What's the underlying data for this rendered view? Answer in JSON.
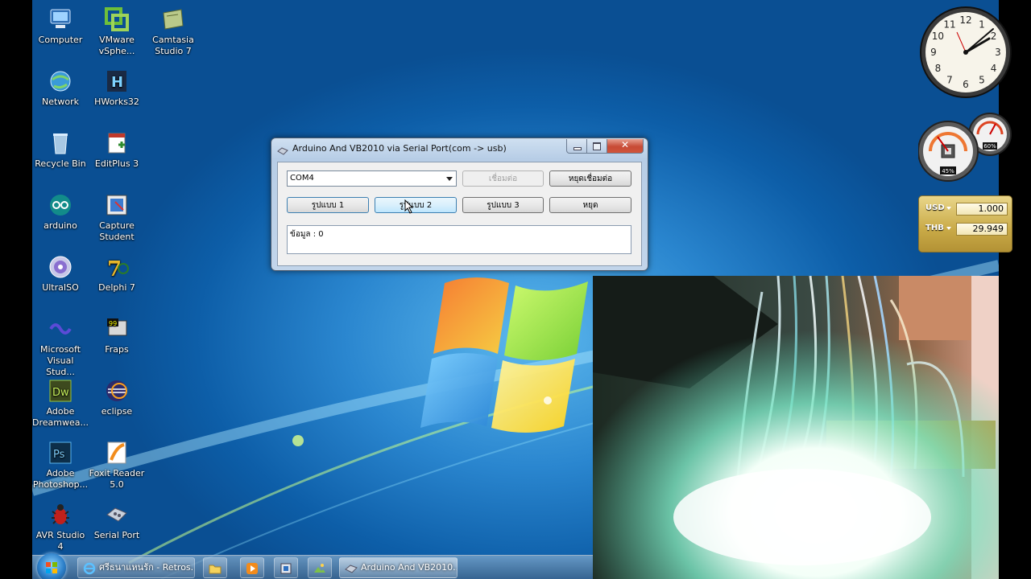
{
  "desktop_icons": [
    {
      "label": "Computer"
    },
    {
      "label": "VMware\nvSphe..."
    },
    {
      "label": "Camtasia\nStudio 7"
    },
    {
      "label": "Network"
    },
    {
      "label": "HWorks32"
    },
    {
      "label": "Recycle Bin"
    },
    {
      "label": "EditPlus 3"
    },
    {
      "label": "arduino"
    },
    {
      "label": "Capture\nStudent"
    },
    {
      "label": "UltraISO"
    },
    {
      "label": "Delphi 7"
    },
    {
      "label": "Microsoft\nVisual Stud..."
    },
    {
      "label": "Fraps"
    },
    {
      "label": "Adobe\nDreamwea..."
    },
    {
      "label": "eclipse"
    },
    {
      "label": "Adobe\nPhotoshop..."
    },
    {
      "label": "Foxit Reader\n5.0"
    },
    {
      "label": "AVR Studio 4"
    },
    {
      "label": "Serial Port"
    }
  ],
  "window": {
    "title": "Arduino And VB2010 via Serial Port(com -> usb)",
    "port_combo": {
      "value": "COM4"
    },
    "buttons": {
      "connect": "เชื่อมต่อ",
      "disconnect": "หยุดเชื่อมต่อ",
      "pattern1": "รูปแบบ 1",
      "pattern2": "รูปแบบ 2",
      "pattern3": "รูปแบบ 3",
      "stop": "หยุด"
    },
    "data_text": "ข้อมูล : 0"
  },
  "gadgets": {
    "clock": {
      "numerals": [
        "12",
        "1",
        "2",
        "3",
        "4",
        "5",
        "6",
        "7",
        "8",
        "9",
        "10",
        "11"
      ]
    },
    "meter": {
      "cpu": "45%",
      "memory": "60%"
    },
    "currency": {
      "row1": {
        "code": "USD",
        "value": "1.000"
      },
      "row2": {
        "code": "THB",
        "value": "29.949"
      }
    }
  },
  "taskbar": {
    "items": [
      {
        "label": "ศรีธนาแหนรัก - Retros..."
      },
      {
        "label": "Arduino And VB2010..."
      }
    ]
  },
  "colors": {
    "desktop_blue": "#1e74c4",
    "close_red": "#c74a35"
  }
}
